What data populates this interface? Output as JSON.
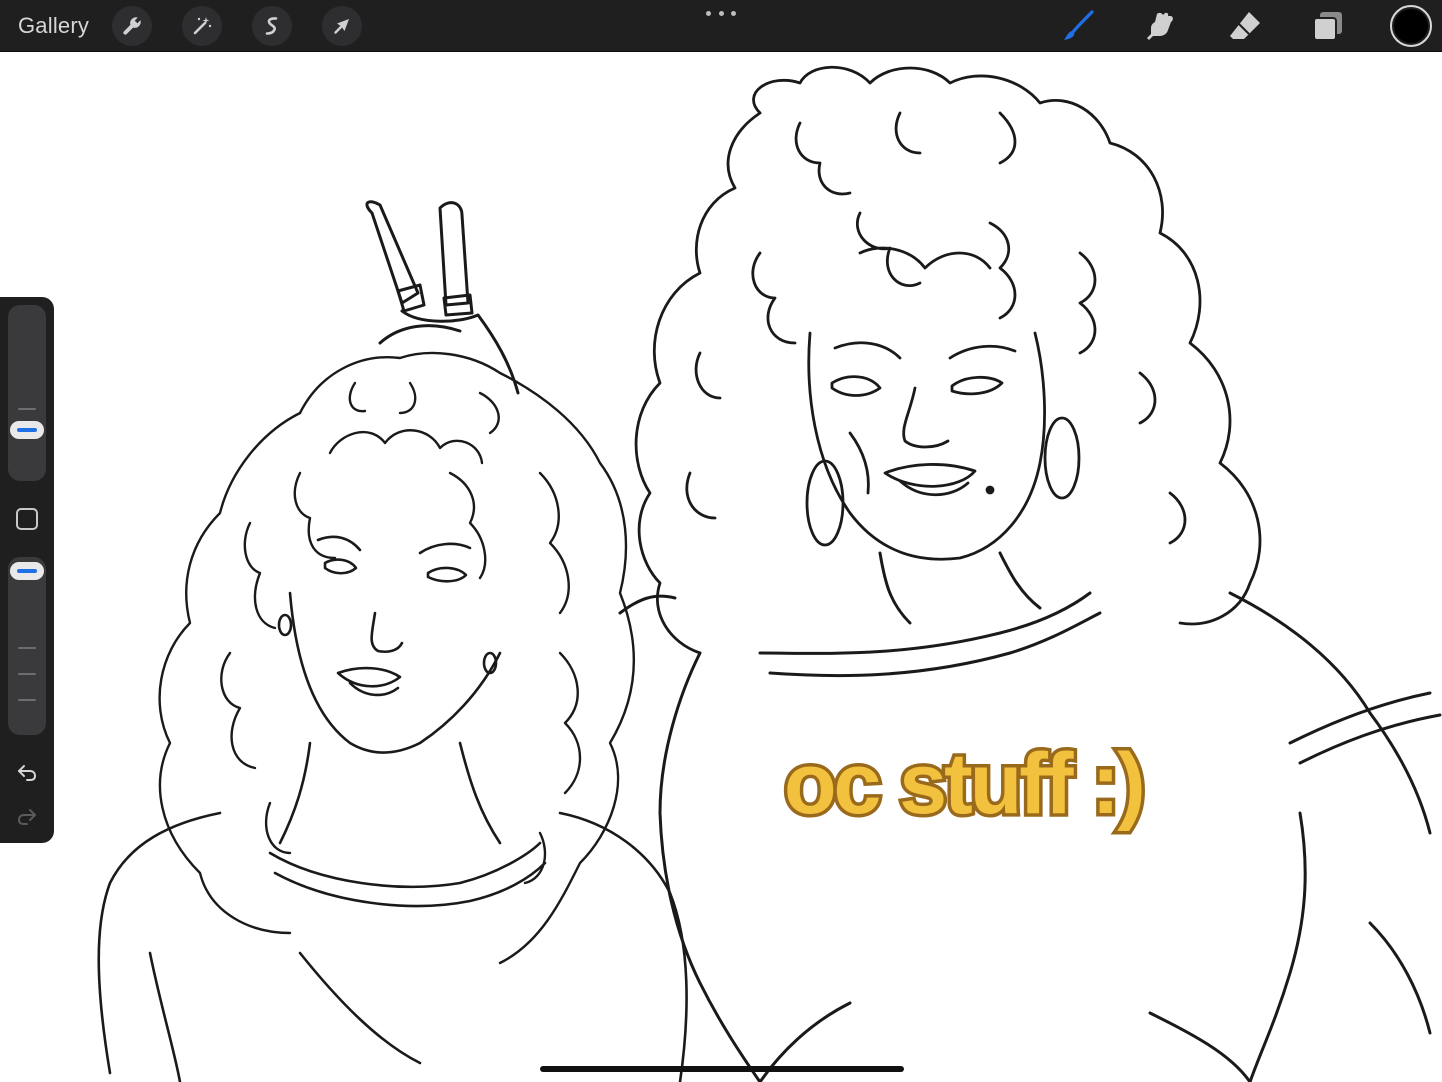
{
  "toolbar": {
    "gallery_label": "Gallery",
    "left_tools": [
      {
        "name": "actions",
        "icon": "wrench-icon"
      },
      {
        "name": "adjustments",
        "icon": "magic-wand-icon"
      },
      {
        "name": "selection",
        "icon": "selection-s-icon"
      },
      {
        "name": "transform",
        "icon": "arrow-cursor-icon"
      }
    ],
    "more_icon": "more-dots-icon",
    "right_tools": [
      {
        "name": "brush",
        "icon": "brush-icon",
        "active": true
      },
      {
        "name": "smudge",
        "icon": "smudge-icon",
        "active": false
      },
      {
        "name": "eraser",
        "icon": "eraser-icon",
        "active": false
      },
      {
        "name": "layers",
        "icon": "layers-icon",
        "active": false
      }
    ],
    "active_color": "#000000",
    "accent_color": "#1f6fe6"
  },
  "sidebar": {
    "brush_size_level": 0.25,
    "brush_opacity_level": 1.0,
    "modify_icon": "modify-square-icon",
    "undo_icon": "undo-icon",
    "redo_icon": "redo-icon",
    "redo_enabled": false
  },
  "canvas": {
    "shirt_text": "oc stuff :)",
    "shirt_text_fill": "#f2c23e",
    "shirt_text_outline": "#9a6a1c"
  }
}
